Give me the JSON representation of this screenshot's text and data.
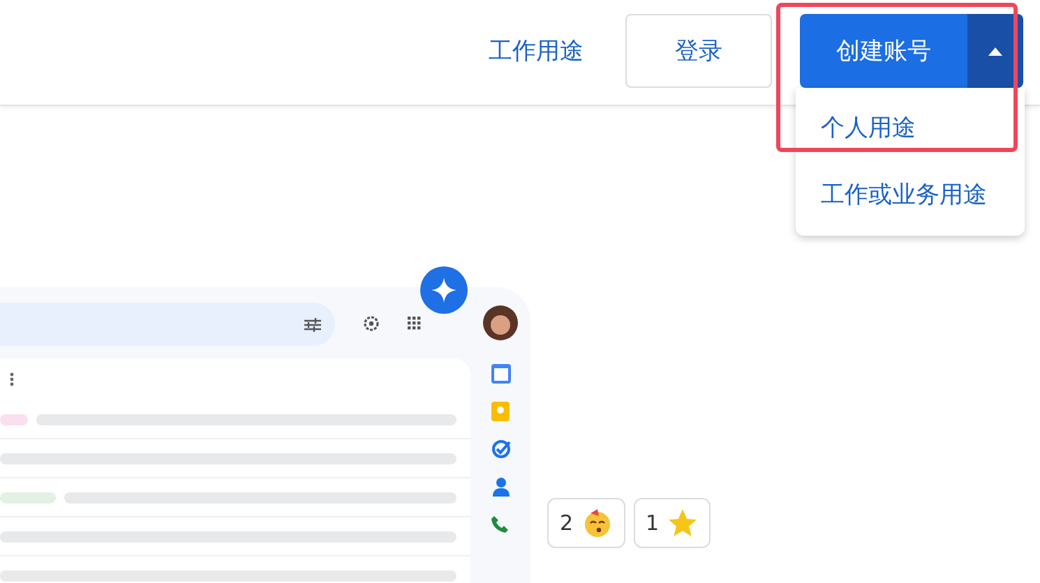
{
  "header": {
    "nav_link": "工作用途",
    "login_button": "登录",
    "create_button": "创建账号",
    "highlight_frame": true,
    "menu": {
      "expanded": true,
      "items": [
        {
          "label": "个人用途"
        },
        {
          "label": "工作或业务用途"
        }
      ]
    }
  },
  "preview": {
    "rows": [
      {
        "kind": "tagged",
        "color": "#f9dff0"
      },
      {
        "kind": "plain"
      },
      {
        "kind": "tagged",
        "color": "#e3f1e4"
      },
      {
        "kind": "plain"
      },
      {
        "kind": "plain"
      }
    ],
    "reactions": [
      {
        "count": "2",
        "kind": "party"
      },
      {
        "count": "1",
        "kind": "star"
      }
    ]
  }
}
